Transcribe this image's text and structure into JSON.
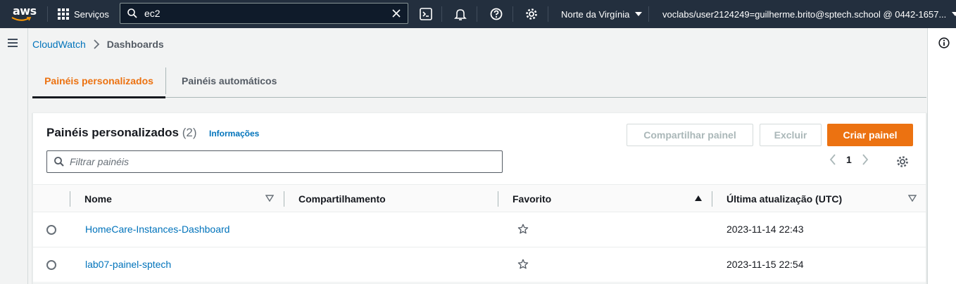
{
  "topnav": {
    "logo_text": "aws",
    "services_label": "Serviços",
    "search_value": "ec2",
    "region_label": "Norte da Virgínia",
    "account_label": "voclabs/user2124249=guilherme.brito@sptech.school @ 0442-1657..."
  },
  "breadcrumb": {
    "root": "CloudWatch",
    "current": "Dashboards"
  },
  "tabs": [
    {
      "label": "Painéis personalizados",
      "active": true
    },
    {
      "label": "Painéis automáticos",
      "active": false
    }
  ],
  "panel": {
    "title": "Painéis personalizados",
    "count": "(2)",
    "info_link": "Informações",
    "share_button": "Compartilhar painel",
    "delete_button": "Excluir",
    "create_button": "Criar painel",
    "filter_placeholder": "Filtrar painéis",
    "current_page": "1"
  },
  "table": {
    "columns": [
      "Nome",
      "Compartilhamento",
      "Favorito",
      "Última atualização (UTC)"
    ],
    "rows": [
      {
        "name": "HomeCare-Instances-Dashboard",
        "sharing": "",
        "favorite": false,
        "updated": "2023-11-14 22:43"
      },
      {
        "name": "lab07-painel-sptech",
        "sharing": "",
        "favorite": false,
        "updated": "2023-11-15 22:54"
      }
    ]
  },
  "colors": {
    "nav_bg": "#232f3e",
    "accent_orange": "#ec7211",
    "link_blue": "#0073bb"
  }
}
